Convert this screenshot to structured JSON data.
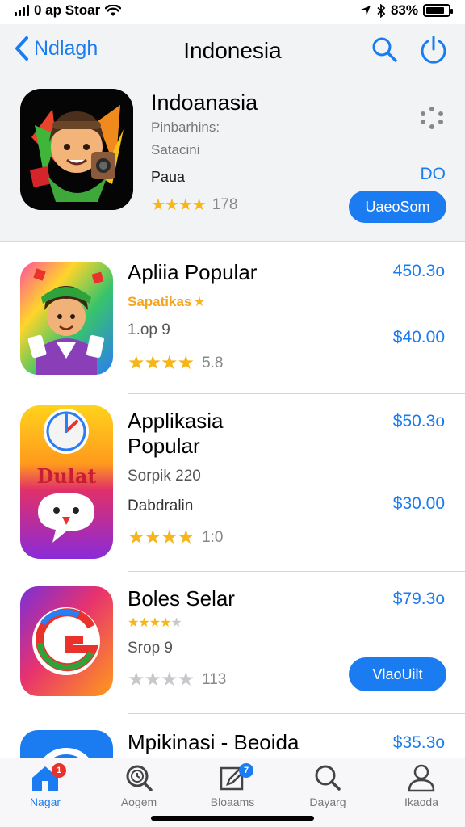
{
  "status": {
    "carrier": "0 ap Stoar",
    "battery_text": "83%",
    "battery_level": 0.83
  },
  "nav": {
    "back_label": "Ndlagh",
    "title": "Indonesia",
    "icons": [
      "search-icon",
      "power-icon"
    ]
  },
  "featured": {
    "name": "Indoanasia",
    "line1": "Pinbarhins:",
    "line2": "Satacini",
    "line3": "Paua",
    "rating_stars": 4,
    "rating_count": "178",
    "price": "DO",
    "button_label": "UaeoSom"
  },
  "apps": [
    {
      "name": "Apliia Popular",
      "subtitle": "Sapatikas",
      "info": "1.op 9",
      "rating_stars": 4,
      "rating_count": "5.8",
      "price_top": "450.3o",
      "price_bottom": "$40.00"
    },
    {
      "name": "Applikasia",
      "name2": "Popular",
      "info": "Sorpik 220",
      "info2": "Dabdralin",
      "icon_text": "Dulat",
      "rating_stars": 4,
      "rating_count": "1:0",
      "price_top": "$50.3o",
      "price_bottom": "$30.00"
    },
    {
      "name": "Boles Selar",
      "info": "Srop 9",
      "rating_stars": 4,
      "rating_count": "113",
      "price_top": "$79.3o",
      "button_label": "VlaoUilt"
    },
    {
      "name": "Mpikinasi - Beoida",
      "price_top": "$35.3o"
    }
  ],
  "tabs": [
    {
      "label": "Nagar",
      "icon": "home-icon",
      "active": true,
      "badge": "1"
    },
    {
      "label": "Aogem",
      "icon": "search-clock-icon",
      "active": false
    },
    {
      "label": "Bloaams",
      "icon": "edit-icon",
      "active": false,
      "badge": "7"
    },
    {
      "label": "Dayarg",
      "icon": "search-icon",
      "active": false
    },
    {
      "label": "Ikaoda",
      "icon": "person-icon",
      "active": false
    }
  ],
  "colors": {
    "accent": "#1a7cf0",
    "star": "#f5b51b",
    "badge_red": "#e8322b"
  }
}
